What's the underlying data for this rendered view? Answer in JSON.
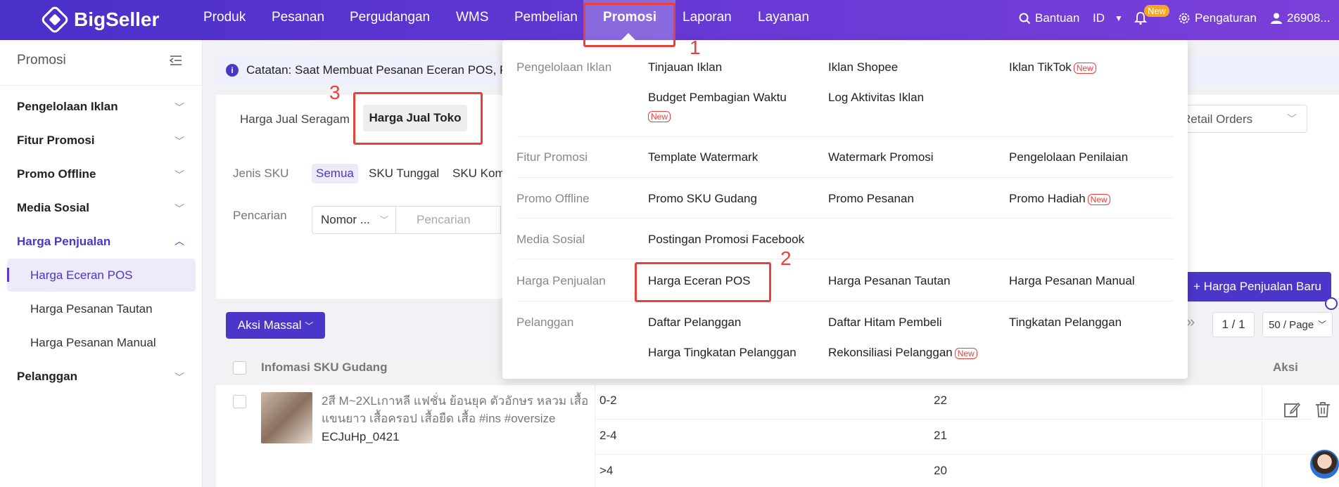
{
  "brand": {
    "name": "BigSeller"
  },
  "nav": {
    "items": [
      "Produk",
      "Pesanan",
      "Pergudangan",
      "WMS",
      "Pembelian",
      "Promosi",
      "Laporan",
      "Layanan"
    ],
    "active": "Promosi"
  },
  "topbar_right": {
    "help": "Bantuan",
    "lang": "ID",
    "new_badge": "New",
    "settings": "Pengaturan",
    "user": "26908..."
  },
  "annotations": {
    "n1": "1",
    "n2": "2",
    "n3": "3"
  },
  "sidebar": {
    "title": "Promosi",
    "groups": [
      "Pengelolaan Iklan",
      "Fitur Promosi",
      "Promo Offline",
      "Media Sosial",
      "Harga Penjualan",
      "Pelanggan"
    ],
    "sub_items": [
      "Harga Eceran POS",
      "Harga Pesanan Tautan",
      "Harga Pesanan Manual"
    ],
    "active_sub": "Harga Eceran POS"
  },
  "notice": {
    "icon": "i",
    "text": "Catatan: Saat Membuat Pesanan Eceran POS, Pri"
  },
  "tabs": {
    "uniform": "Harga Jual Seragam",
    "store": "Harga Jual Toko"
  },
  "retail_select": "Retail Orders",
  "filters": {
    "sku_label": "Jenis SKU",
    "sku_options": [
      "Semua",
      "SKU Tunggal",
      "SKU Kom"
    ],
    "search_label": "Pencarian",
    "search_select": "Nomor ...",
    "search_placeholder": "Pencarian"
  },
  "buttons": {
    "new_price": "+ Harga Penjualan Baru",
    "bulk": "Aksi Massal"
  },
  "pager": {
    "page": "1 / 1",
    "size": "50 / Page"
  },
  "table": {
    "headers": {
      "sku_info": "Infomasi SKU Gudang",
      "action": "Aksi"
    },
    "row": {
      "name": "2สี M~2XLเกาหลี แฟชั่น ย้อนยุค ตัวอักษร หลวม เสื้อแขนยาว เสื้อครอป เสื้อยืด เสื้อ #ins #oversize",
      "code": "ECJuHp_0421",
      "tiers": [
        {
          "qty": "0-2",
          "price": "22"
        },
        {
          "qty": "2-4",
          "price": "21"
        },
        {
          "qty": ">4",
          "price": "20"
        }
      ]
    }
  },
  "dropdown": {
    "new_tag": "New",
    "sections": [
      {
        "category": "Pengelolaan Iklan",
        "items": [
          "Tinjauan Iklan",
          "Iklan Shopee",
          "Iklan TikTok",
          "Budget Pembagian Waktu",
          "Log Aktivitas Iklan"
        ]
      },
      {
        "category": "Fitur Promosi",
        "items": [
          "Template Watermark",
          "Watermark Promosi",
          "Pengelolaan Penilaian"
        ]
      },
      {
        "category": "Promo Offline",
        "items": [
          "Promo SKU Gudang",
          "Promo Pesanan",
          "Promo Hadiah"
        ]
      },
      {
        "category": "Media Sosial",
        "items": [
          "Postingan Promosi Facebook"
        ]
      },
      {
        "category": "Harga Penjualan",
        "items": [
          "Harga Eceran POS",
          "Harga Pesanan Tautan",
          "Harga Pesanan Manual"
        ]
      },
      {
        "category": "Pelanggan",
        "items": [
          "Daftar Pelanggan",
          "Daftar Hitam Pembeli",
          "Tingkatan Pelanggan",
          "Harga Tingkatan Pelanggan",
          "Rekonsiliasi Pelanggan"
        ]
      }
    ]
  }
}
